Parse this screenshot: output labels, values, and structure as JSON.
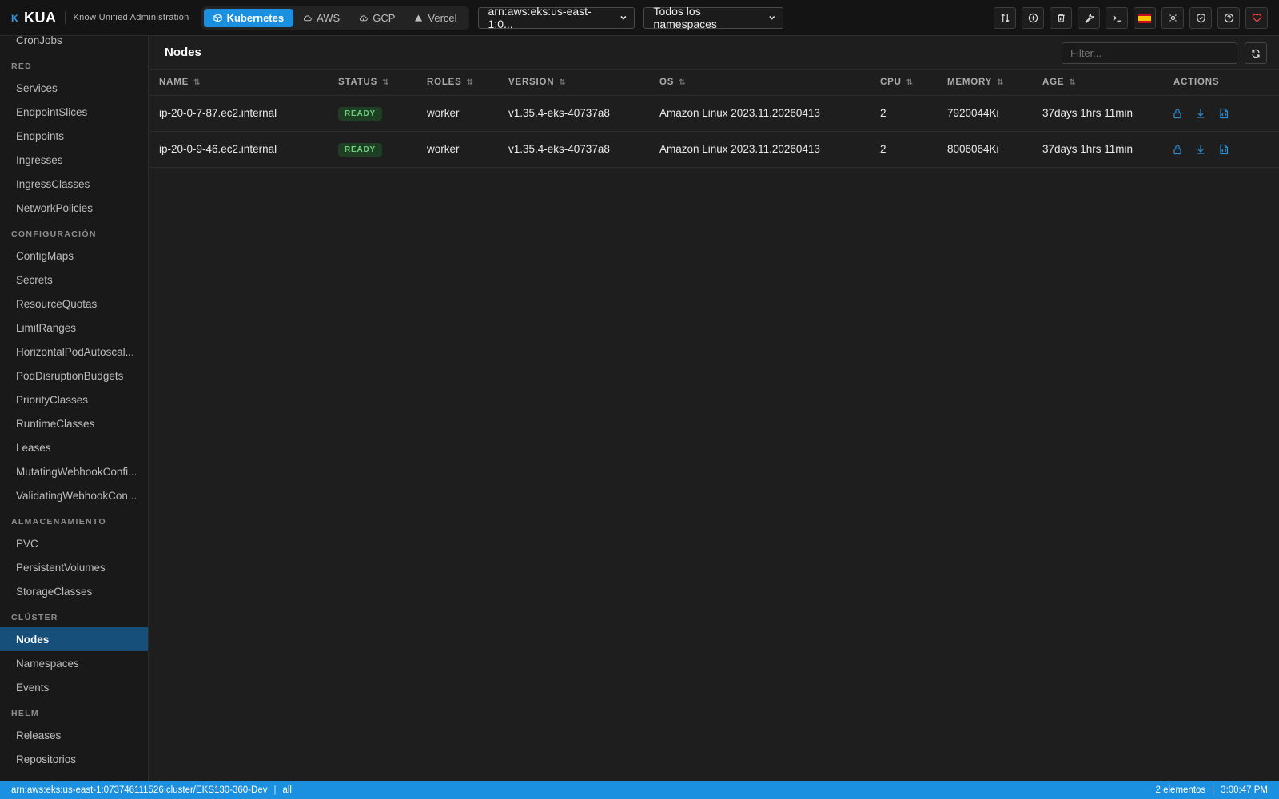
{
  "app": {
    "logo": "KUA",
    "subtitle": "Know Unified Administration"
  },
  "providers": [
    {
      "label": "Kubernetes",
      "icon": "cube-icon",
      "active": true
    },
    {
      "label": "AWS",
      "icon": "cloud-icon",
      "active": false
    },
    {
      "label": "GCP",
      "icon": "cloud-icon",
      "active": false
    },
    {
      "label": "Vercel",
      "icon": "triangle-icon",
      "active": false
    }
  ],
  "cluster_select": {
    "value": "arn:aws:eks:us-east-1:0..."
  },
  "namespace_select": {
    "value": "Todos los namespaces"
  },
  "toolbar_icons": [
    "swap-icon",
    "plus-circle-icon",
    "trash-icon",
    "wrench-icon",
    "terminal-icon",
    "flag-es-icon",
    "sun-icon",
    "shield-icon",
    "help-icon",
    "heart-icon"
  ],
  "sidebar": {
    "top_item": "CronJobs",
    "sections": [
      {
        "title": "RED",
        "items": [
          "Services",
          "EndpointSlices",
          "Endpoints",
          "Ingresses",
          "IngressClasses",
          "NetworkPolicies"
        ]
      },
      {
        "title": "CONFIGURACIÓN",
        "items": [
          "ConfigMaps",
          "Secrets",
          "ResourceQuotas",
          "LimitRanges",
          "HorizontalPodAutoscal...",
          "PodDisruptionBudgets",
          "PriorityClasses",
          "RuntimeClasses",
          "Leases",
          "MutatingWebhookConfi...",
          "ValidatingWebhookCon..."
        ]
      },
      {
        "title": "ALMACENAMIENTO",
        "items": [
          "PVC",
          "PersistentVolumes",
          "StorageClasses"
        ]
      },
      {
        "title": "CLÚSTER",
        "items": [
          "Nodes",
          "Namespaces",
          "Events"
        ]
      },
      {
        "title": "HELM",
        "items": [
          "Releases",
          "Repositorios"
        ]
      }
    ],
    "active": "Nodes"
  },
  "main": {
    "title": "Nodes",
    "filter_placeholder": "Filter...",
    "columns": [
      "NAME",
      "STATUS",
      "ROLES",
      "VERSION",
      "OS",
      "CPU",
      "MEMORY",
      "AGE",
      "ACTIONS"
    ],
    "rows": [
      {
        "name": "ip-20-0-7-87.ec2.internal",
        "status": "READY",
        "roles": "worker",
        "version": "v1.35.4-eks-40737a8",
        "os": "Amazon Linux 2023.11.20260413",
        "cpu": "2",
        "memory": "7920044Ki",
        "age": "37days 1hrs 11min"
      },
      {
        "name": "ip-20-0-9-46.ec2.internal",
        "status": "READY",
        "roles": "worker",
        "version": "v1.35.4-eks-40737a8",
        "os": "Amazon Linux 2023.11.20260413",
        "cpu": "2",
        "memory": "8006064Ki",
        "age": "37days 1hrs 11min"
      }
    ]
  },
  "statusbar": {
    "cluster": "arn:aws:eks:us-east-1:073746111526:cluster/EKS130-360-Dev",
    "sep": "|",
    "namespace": "all",
    "count": "2 elementos",
    "time": "3:00:47 PM"
  }
}
